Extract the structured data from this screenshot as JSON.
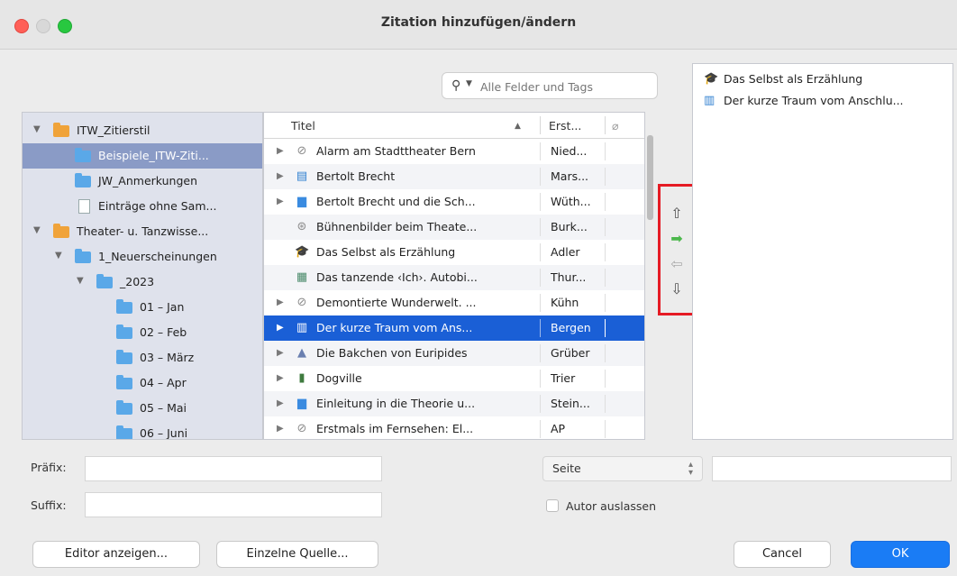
{
  "window": {
    "title": "Zitation hinzufügen/ändern"
  },
  "search": {
    "placeholder": "Alle Felder und Tags"
  },
  "tree": {
    "items": [
      {
        "label": "ITW_Zitierstil"
      },
      {
        "label": "Beispiele_ITW-Ziti..."
      },
      {
        "label": "JW_Anmerkungen"
      },
      {
        "label": "Einträge ohne Sam..."
      },
      {
        "label": "Theater- u. Tanzwisse..."
      },
      {
        "label": "1_Neuerscheinungen"
      },
      {
        "label": "_2023"
      },
      {
        "label": "01 – Jan"
      },
      {
        "label": "02 – Feb"
      },
      {
        "label": "03 – März"
      },
      {
        "label": "04 – Apr"
      },
      {
        "label": "05 – Mai"
      },
      {
        "label": "06 – Juni"
      }
    ]
  },
  "table": {
    "headers": {
      "title": "Titel",
      "author": "Erst..."
    },
    "rows": [
      {
        "title": "Alarm am Stadttheater Bern",
        "author": "Nied...",
        "icon": "attachment-icon"
      },
      {
        "title": "Bertolt Brecht",
        "author": "Mars...",
        "icon": "book-icon"
      },
      {
        "title": "Bertolt Brecht und die Sch...",
        "author": "Wüth...",
        "icon": "document-icon"
      },
      {
        "title": "Bühnenbilder beim Theate...",
        "author": "Burk...",
        "icon": "web-page-icon"
      },
      {
        "title": "Das Selbst als Erzählung",
        "author": "Adler",
        "icon": "thesis-icon"
      },
      {
        "title": "Das tanzende ‹Ich›. Autobi...",
        "author": "Thur...",
        "icon": "presentation-icon"
      },
      {
        "title": "Demontierte Wunderwelt. ...",
        "author": "Kühn",
        "icon": "attachment-icon"
      },
      {
        "title": "Der kurze Traum vom Ans...",
        "author": "Bergen",
        "icon": "book-section-icon"
      },
      {
        "title": "Die Bakchen von Euripides",
        "author": "Grüber",
        "icon": "artwork-icon"
      },
      {
        "title": "Dogville",
        "author": "Trier",
        "icon": "film-icon"
      },
      {
        "title": "Einleitung in die Theorie u...",
        "author": "Stein...",
        "icon": "document-icon"
      },
      {
        "title": "Erstmals im Fernsehen: El...",
        "author": "AP",
        "icon": "attachment-icon"
      }
    ]
  },
  "selected": {
    "items": [
      {
        "title": "Das Selbst als Erzählung",
        "icon": "thesis-icon"
      },
      {
        "title": "Der kurze Traum vom Anschlu...",
        "icon": "book-section-icon"
      }
    ]
  },
  "form": {
    "prefix_label": "Präfix:",
    "suffix_label": "Suffix:",
    "locator_value": "Seite",
    "omit_author_label": "Autor auslassen"
  },
  "buttons": {
    "editor": "Editor anzeigen...",
    "single": "Einzelne Quelle...",
    "cancel": "Cancel",
    "ok": "OK"
  },
  "colors": {
    "selection": "#1a5fd6",
    "tree_selection": "#8a9bc6",
    "accent": "#1a7cf5",
    "highlight_box": "#e51b24"
  }
}
